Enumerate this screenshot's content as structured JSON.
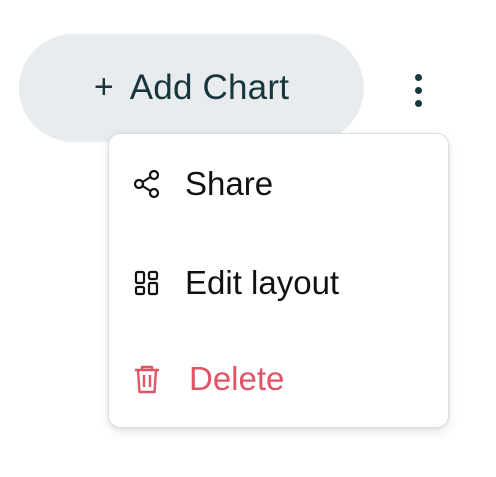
{
  "toolbar": {
    "add_chart_plus": "+",
    "add_chart_label": "Add Chart",
    "more_icon": "kebab-vertical-icon"
  },
  "menu": {
    "items": [
      {
        "label": "Share",
        "icon": "share-icon",
        "color": "#111111"
      },
      {
        "label": "Edit layout",
        "icon": "layout-grid-icon",
        "color": "#111111"
      },
      {
        "label": "Delete",
        "icon": "trash-icon",
        "color": "#e05467"
      }
    ]
  },
  "colors": {
    "button_bg": "#e8ecee",
    "button_text": "#17363b",
    "danger": "#e05467"
  }
}
